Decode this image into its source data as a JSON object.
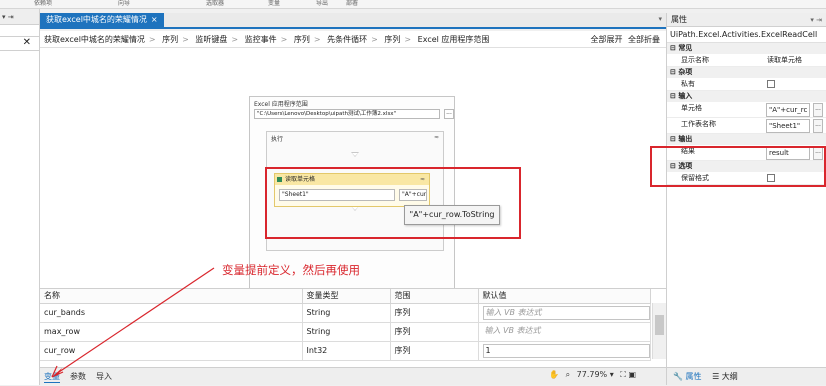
{
  "ribbon": {
    "items": [
      "依赖项",
      "向导",
      "选取器",
      "变量",
      "导出",
      "部署"
    ]
  },
  "left_panel": {
    "pin": "▾ ⇥",
    "close": "✕"
  },
  "doc_tab": {
    "label": "获取excel中城名的荣耀情况",
    "close": "×"
  },
  "breadcrumb": {
    "items": [
      "获取excel中城名的荣耀情况",
      "序列",
      "监听键盘",
      "监控事件",
      "序列",
      "先条件循环",
      "序列",
      "Excel 应用程序范围"
    ],
    "expand_all": "全部展开",
    "collapse_all": "全部折叠"
  },
  "designer": {
    "scope_title": "Excel 应用程序范围",
    "scope_path": "\"C:\\Users\\Lenovo\\Desktop\\uipath测试\\工作簿2.xlsx\"",
    "scope_browse": "...",
    "exec_title": "执行",
    "activity_title": "读取单元格",
    "sheet_value": "\"Sheet1\"",
    "cell_value": "\"A\"+cur_",
    "tooltip": "\"A\"+cur_row.ToString"
  },
  "annotation": {
    "text": "变量提前定义，然后再使用",
    "color": "#d9262d"
  },
  "variables": {
    "headers": [
      "名称",
      "变量类型",
      "范围",
      "默认值"
    ],
    "rows": [
      {
        "name": "cur_bands",
        "type": "String",
        "scope": "序列",
        "default": "输入 VB 表达式",
        "placeholder": true
      },
      {
        "name": "max_row",
        "type": "String",
        "scope": "序列",
        "default": "输入 VB 表达式",
        "placeholder": true
      },
      {
        "name": "cur_row",
        "type": "Int32",
        "scope": "序列",
        "default": "1",
        "placeholder": false
      }
    ]
  },
  "bottom_tabs": {
    "vars": "变量",
    "args": "参数",
    "imports": "导入",
    "zoom": "77.79%"
  },
  "properties": {
    "title": "属性",
    "class_name": "UiPath.Excel.Activities.ExcelReadCell",
    "categories": {
      "common": "常见",
      "misc": "杂项",
      "input": "输入",
      "output": "输出",
      "options": "选项"
    },
    "display_name_label": "显示名称",
    "display_name_value": "读取单元格",
    "private_label": "私有",
    "cell_label": "单元格",
    "cell_value": "\"A\"+cur_rc",
    "sheet_label": "工作表名称",
    "sheet_value": "\"Sheet1\"",
    "result_label": "结果",
    "result_value": "result",
    "preserve_label": "保留格式",
    "bottom_props": "属性",
    "bottom_outline": "大纲"
  }
}
